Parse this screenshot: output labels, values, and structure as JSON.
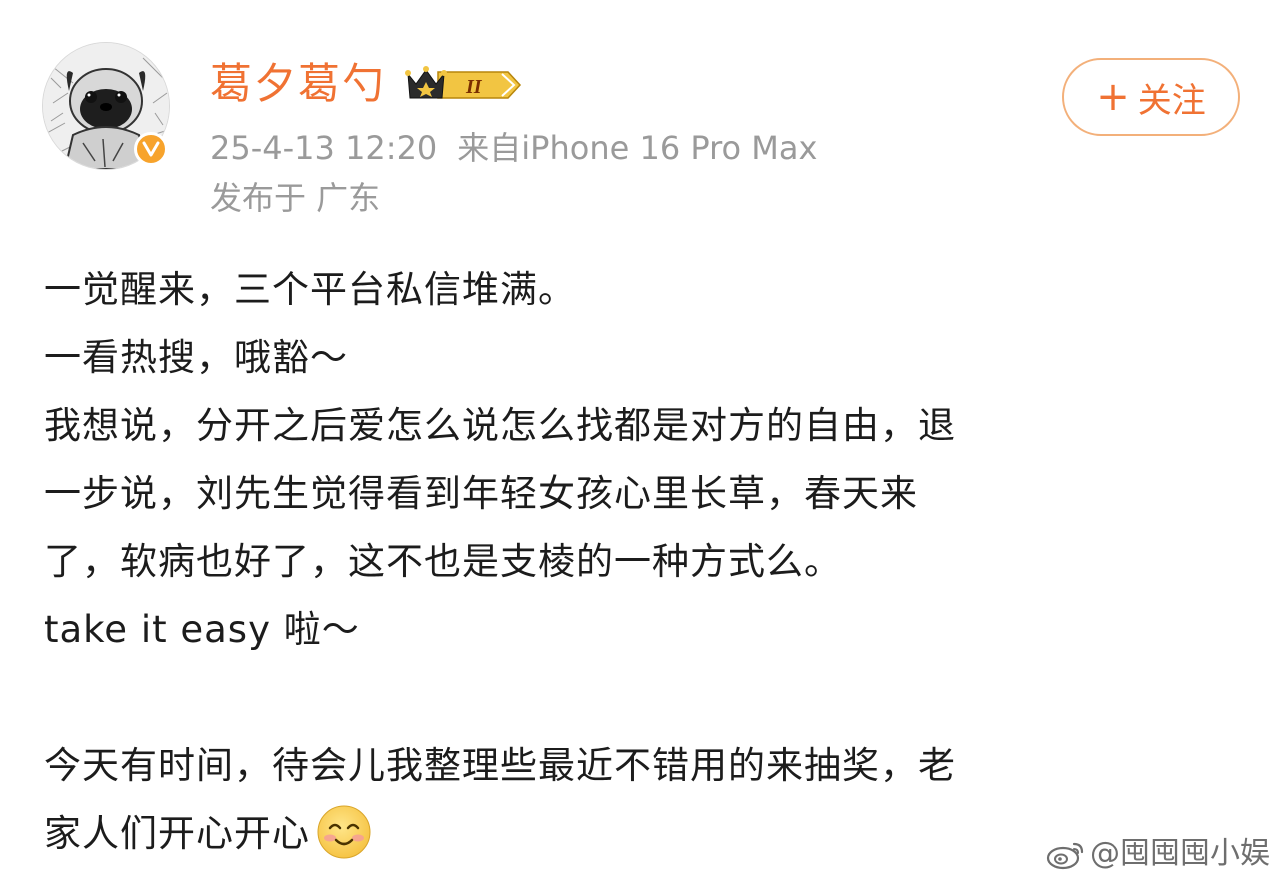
{
  "header": {
    "username": "葛夕葛勺",
    "vip_level": "II",
    "timestamp": "25-4-13 12:20",
    "source": "来自iPhone 16 Pro Max",
    "location": "发布于 广东",
    "follow_label": "关注",
    "follow_plus": "+"
  },
  "post": {
    "lines": [
      "一觉醒来，三个平台私信堆满。",
      "一看热搜，哦豁～",
      "我想说，分开之后爱怎么说怎么找都是对方的自由，退",
      "一步说，刘先生觉得看到年轻女孩心里长草，春天来",
      "了，软病也好了，这不也是支棱的一种方式么。",
      "take it easy 啦～",
      "",
      "今天有时间，待会儿我整理些最近不错用的来抽奖，老",
      "家人们开心开心"
    ],
    "emoji": "smile-icon"
  },
  "watermark": {
    "text": "@囤囤囤小娱",
    "icon": "weibo-logo-icon"
  },
  "colors": {
    "accent": "#f07233",
    "meta": "#9a9a9a",
    "follow_border": "#f3b07a",
    "verified": "#f7a32c"
  }
}
